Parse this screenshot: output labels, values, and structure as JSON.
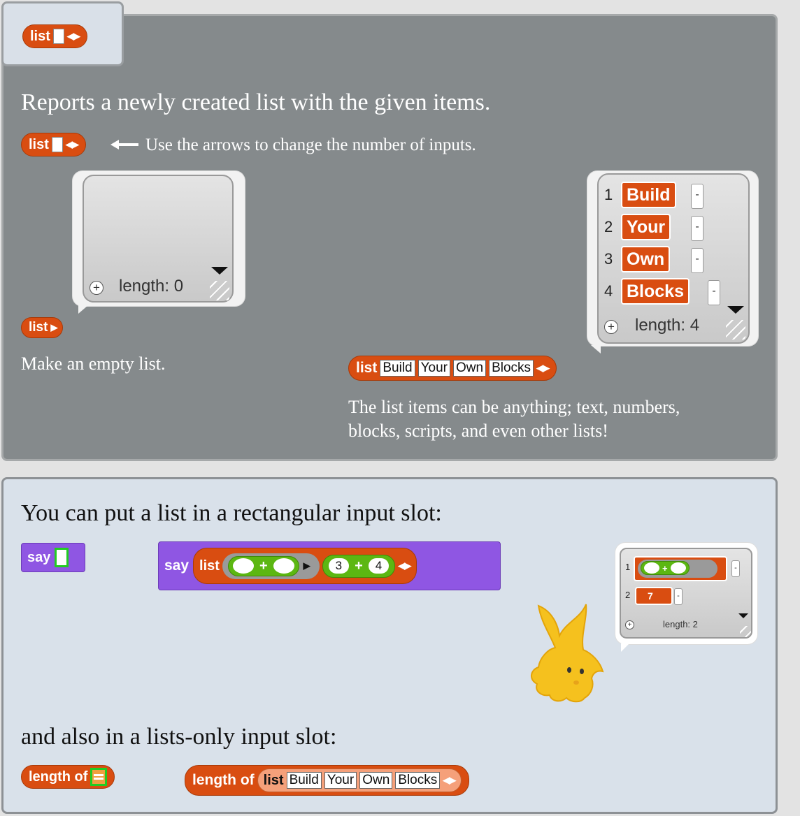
{
  "primary_block": {
    "label": "list"
  },
  "panel1": {
    "description": "Reports a newly created list with the given items.",
    "arrows_hint": "Use the arrows to change the number of inputs.",
    "empty_list_caption": "Make an empty list.",
    "empty_watcher": {
      "length_label": "length: 0"
    },
    "example_block": {
      "label": "list",
      "items": [
        "Build",
        "Your",
        "Own",
        "Blocks"
      ]
    },
    "filled_watcher": {
      "indices": [
        "1",
        "2",
        "3",
        "4"
      ],
      "items": [
        "Build",
        "Your",
        "Own",
        "Blocks"
      ],
      "minus": "-",
      "length_label": "length: 4"
    },
    "items_note_line1": "The list items can be anything; text, numbers,",
    "items_note_line2": "blocks, scripts, and even other lists!"
  },
  "panel2": {
    "rect_slot_text": "You can put a list in a rectangular input slot:",
    "say_label": "say",
    "list_label": "list",
    "plus": "+",
    "num_a": "3",
    "num_b": "4",
    "watcher": {
      "indices": [
        "1",
        "2"
      ],
      "value": "7",
      "length_label": "length: 2"
    },
    "lists_slot_text": "and also in a lists-only input slot:",
    "length_of_label": "length of",
    "length_list_items": [
      "Build",
      "Your",
      "Own",
      "Blocks"
    ]
  },
  "colors": {
    "list_block": "#d94d11",
    "motion_purple": "#8f56e3",
    "operator_green": "#5cb712",
    "panel_gray": "#858a8c",
    "panel_blue": "#d9e1ea"
  }
}
